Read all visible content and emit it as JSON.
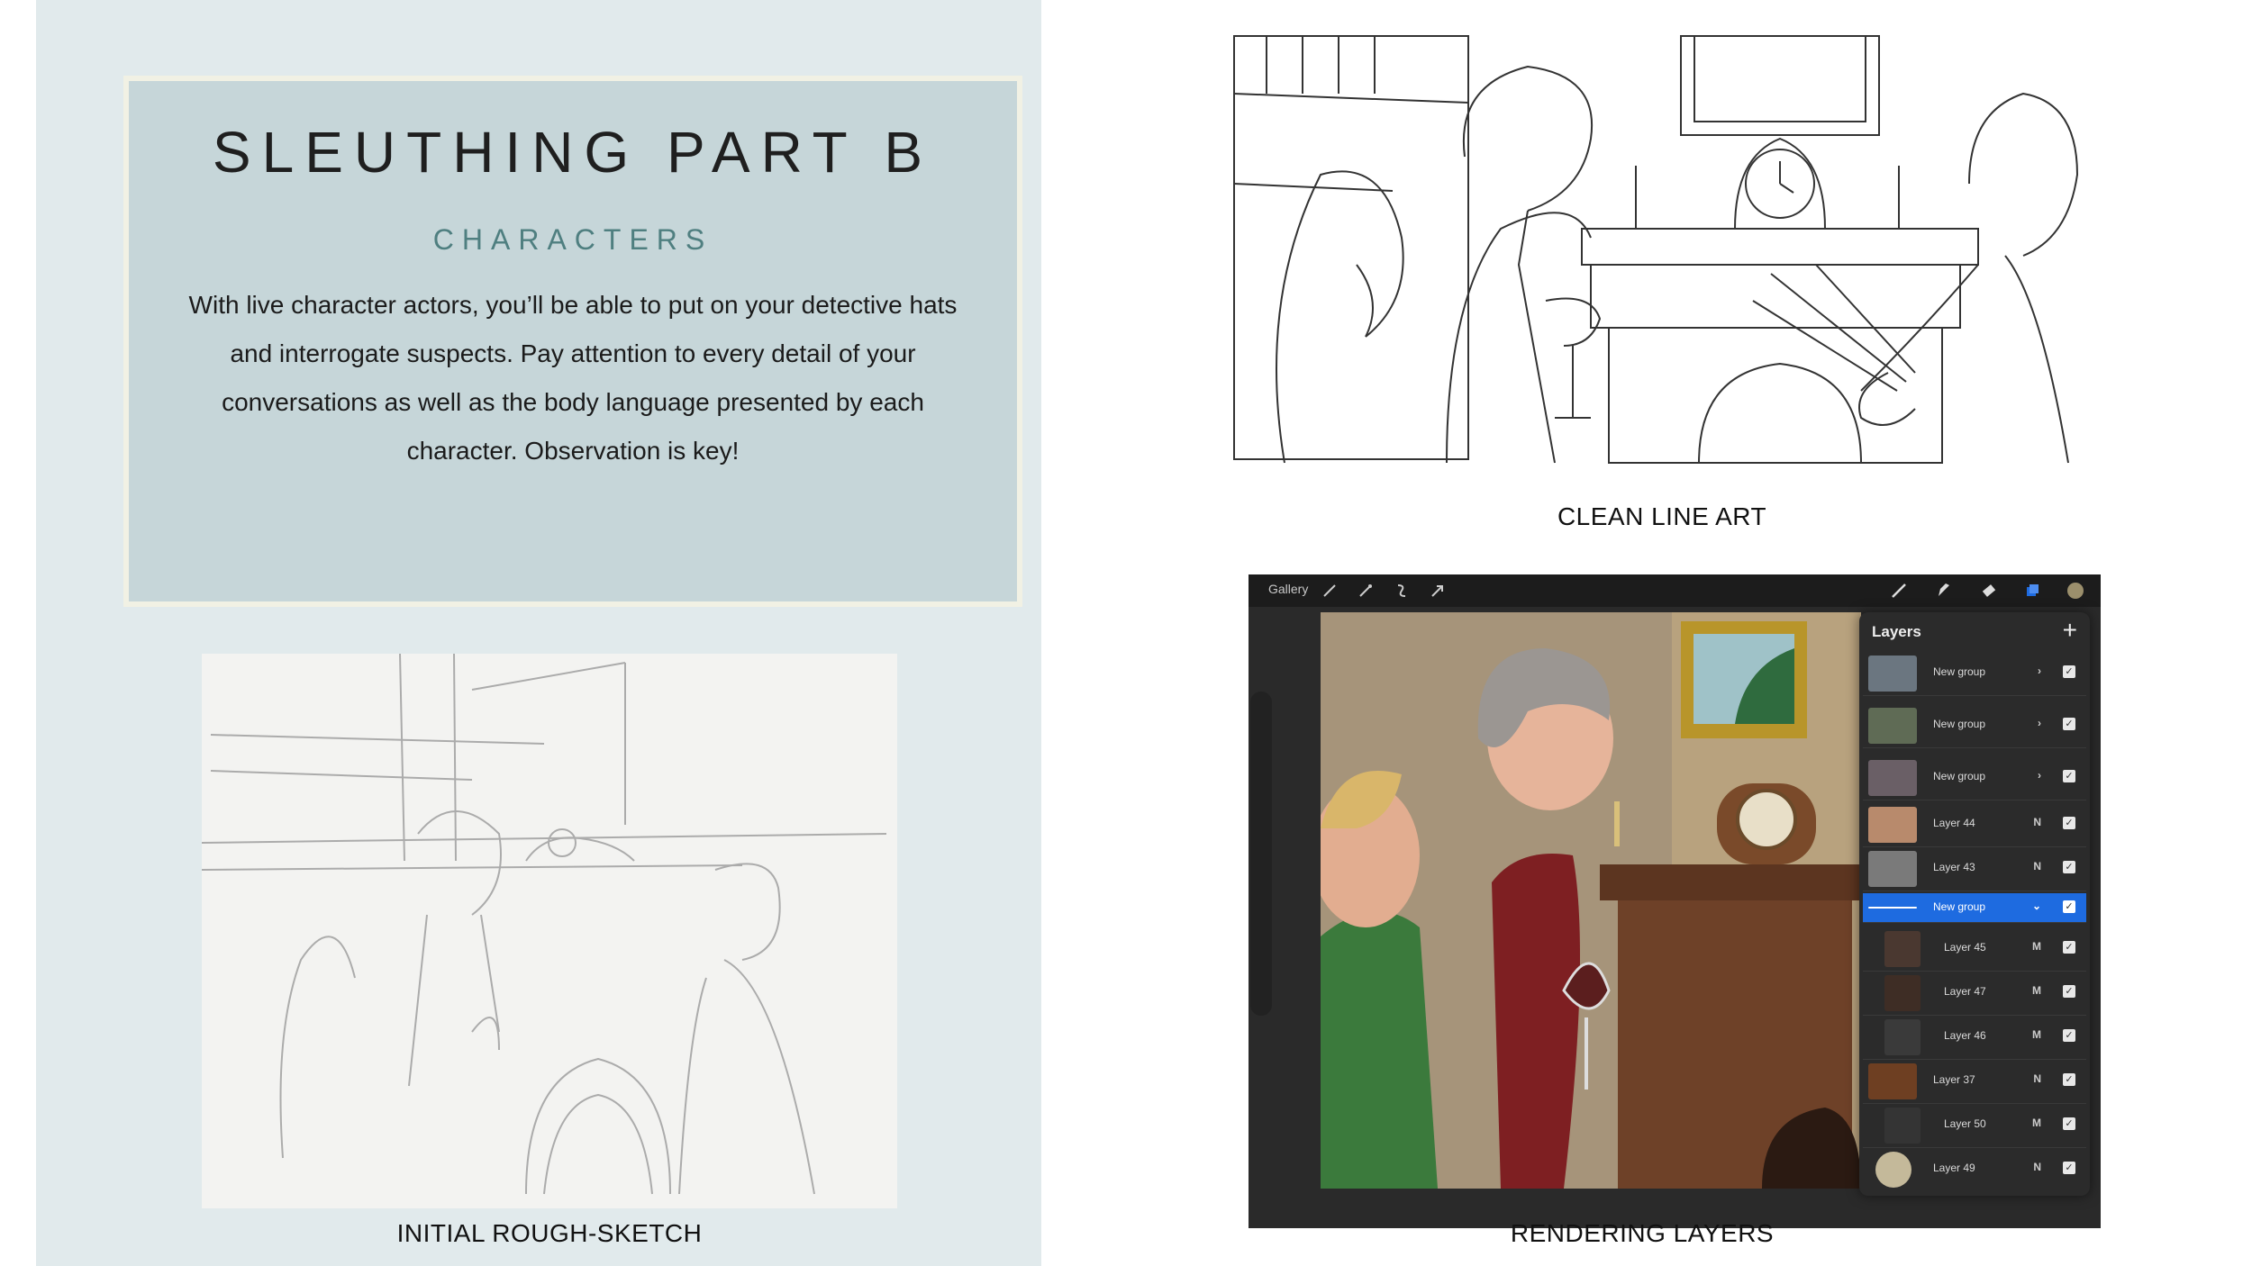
{
  "title_card": {
    "title": "SLEUTHING PART B",
    "subtitle": "CHARACTERS",
    "body": "With live character actors, you’ll be able to put on your detective hats and interrogate suspects. Pay attention to every detail of your conversations as well as the body language presented by each character. Observation is key!"
  },
  "captions": {
    "rough_sketch": "INITIAL ROUGH-SKETCH",
    "line_art": "CLEAN LINE ART",
    "rendering": "RENDERING LAYERS"
  },
  "procreate": {
    "gallery_label": "Gallery",
    "toolbar_icons": [
      "wrench-icon",
      "magic-wand-icon",
      "selection-icon",
      "arrow-icon"
    ],
    "tool_icons": [
      "brush-icon",
      "smudge-icon",
      "eraser-icon",
      "layers-icon",
      "color-swatch-icon"
    ],
    "accent_color": "#1e6be0",
    "layers_title": "Layers",
    "layers": [
      {
        "name": "New group",
        "mode": "›",
        "selected": false
      },
      {
        "name": "New group",
        "mode": "›",
        "selected": false
      },
      {
        "name": "New group",
        "mode": "›",
        "selected": false
      },
      {
        "name": "Layer 44",
        "mode": "N",
        "selected": false
      },
      {
        "name": "Layer 43",
        "mode": "N",
        "selected": false
      },
      {
        "name": "New group",
        "mode": "⌄",
        "selected": true
      },
      {
        "name": "Layer 45",
        "mode": "M",
        "selected": false
      },
      {
        "name": "Layer 47",
        "mode": "M",
        "selected": false
      },
      {
        "name": "Layer 46",
        "mode": "M",
        "selected": false
      },
      {
        "name": "Layer 37",
        "mode": "N",
        "selected": false
      },
      {
        "name": "Layer 50",
        "mode": "M",
        "selected": false
      },
      {
        "name": "Layer 49",
        "mode": "N",
        "selected": false
      }
    ]
  }
}
